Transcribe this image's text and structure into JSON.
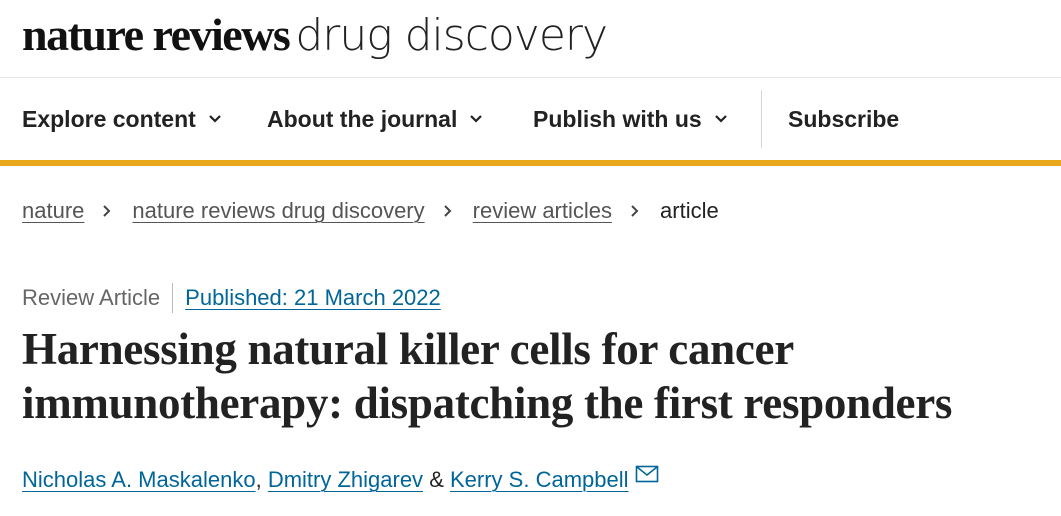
{
  "brand": {
    "bold": "nature reviews",
    "light": "drug discovery"
  },
  "nav": {
    "items": [
      {
        "label": "Explore content",
        "has_menu": true
      },
      {
        "label": "About the journal",
        "has_menu": true
      },
      {
        "label": "Publish with us",
        "has_menu": true
      },
      {
        "label": "Subscribe",
        "has_menu": false
      }
    ]
  },
  "breadcrumb": [
    "nature",
    "nature reviews drug discovery",
    "review articles",
    "article"
  ],
  "article": {
    "type": "Review Article",
    "published": "Published: 21 March 2022",
    "title": "Harnessing natural killer cells for cancer immunotherapy: dispatching the first responders",
    "authors": [
      "Nicholas A. Maskalenko",
      "Dmitry Zhigarev",
      "Kerry S. Campbell"
    ],
    "author_sep_1": ",",
    "author_sep_2": "&"
  },
  "colors": {
    "accent": "#e8a81b",
    "link": "#006699",
    "text": "#222222"
  },
  "icons": {
    "menu": "chevron-down-icon",
    "breadcrumb_sep": "chevron-right-icon",
    "contact": "mail-icon"
  }
}
